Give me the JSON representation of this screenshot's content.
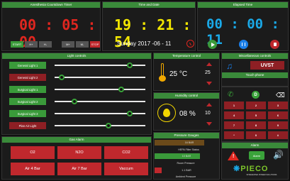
{
  "anesthesia": {
    "header": "Anesthesia Countdown Timer",
    "time": "00 : 05 : 00",
    "buttons": [
      "START",
      "H+",
      "H-",
      "M+",
      "M-",
      "STOP"
    ]
  },
  "timedate": {
    "header": "Time and Date",
    "time": "19 : 21 : 54",
    "date": "Sunday 2017 -06 - 11"
  },
  "elapsed": {
    "header": "Elapsed Time",
    "time": "00 : 00 : 11"
  },
  "lights": {
    "header": "Light controls",
    "items": [
      "General Light 1",
      "General Light 2",
      "Surgical Light 1",
      "Surgical Light 2",
      "Surgical Light 3",
      "Plan Air Light"
    ],
    "levels": [
      0.85,
      0.05,
      0.75,
      0.2,
      0.85,
      0.6
    ]
  },
  "temperature": {
    "header": "Temperature control",
    "value": "25 °C",
    "set": "25"
  },
  "humidity": {
    "header": "Humidity control",
    "value": "08 %",
    "set": "10"
  },
  "pressure": {
    "header": "Pressure Gauges",
    "v1": "16 BAR",
    "l1": "HEPA Filter Status",
    "v2": "10 BAR",
    "l2": "Room Pressure",
    "v3": "1.1 BAR",
    "l3": "Ambient Pressure"
  },
  "misc": {
    "header": "Miscellaneous controls",
    "uvst": "UVST"
  },
  "touch": {
    "header": "Touch phone",
    "keys": [
      "1",
      "2",
      "3",
      "4",
      "5",
      "6",
      "7",
      "8",
      "9",
      "*",
      "0",
      "#"
    ]
  },
  "alarm": {
    "header": "Alarm",
    "button": "Alarm"
  },
  "gas": {
    "header": "Gas Alarm",
    "items": [
      "O2",
      "N2O",
      "CO2",
      "Air 4 Bar",
      "Air 7 Bar",
      "Vaccum"
    ]
  },
  "brand": {
    "name": "PIECO",
    "sub": "INTEGRATED POWER SOLUTIONS"
  },
  "colors": {
    "red": "#e0261f",
    "yellow": "#f2e600",
    "cyan": "#1aa9e8",
    "green": "#3a8a3a"
  }
}
